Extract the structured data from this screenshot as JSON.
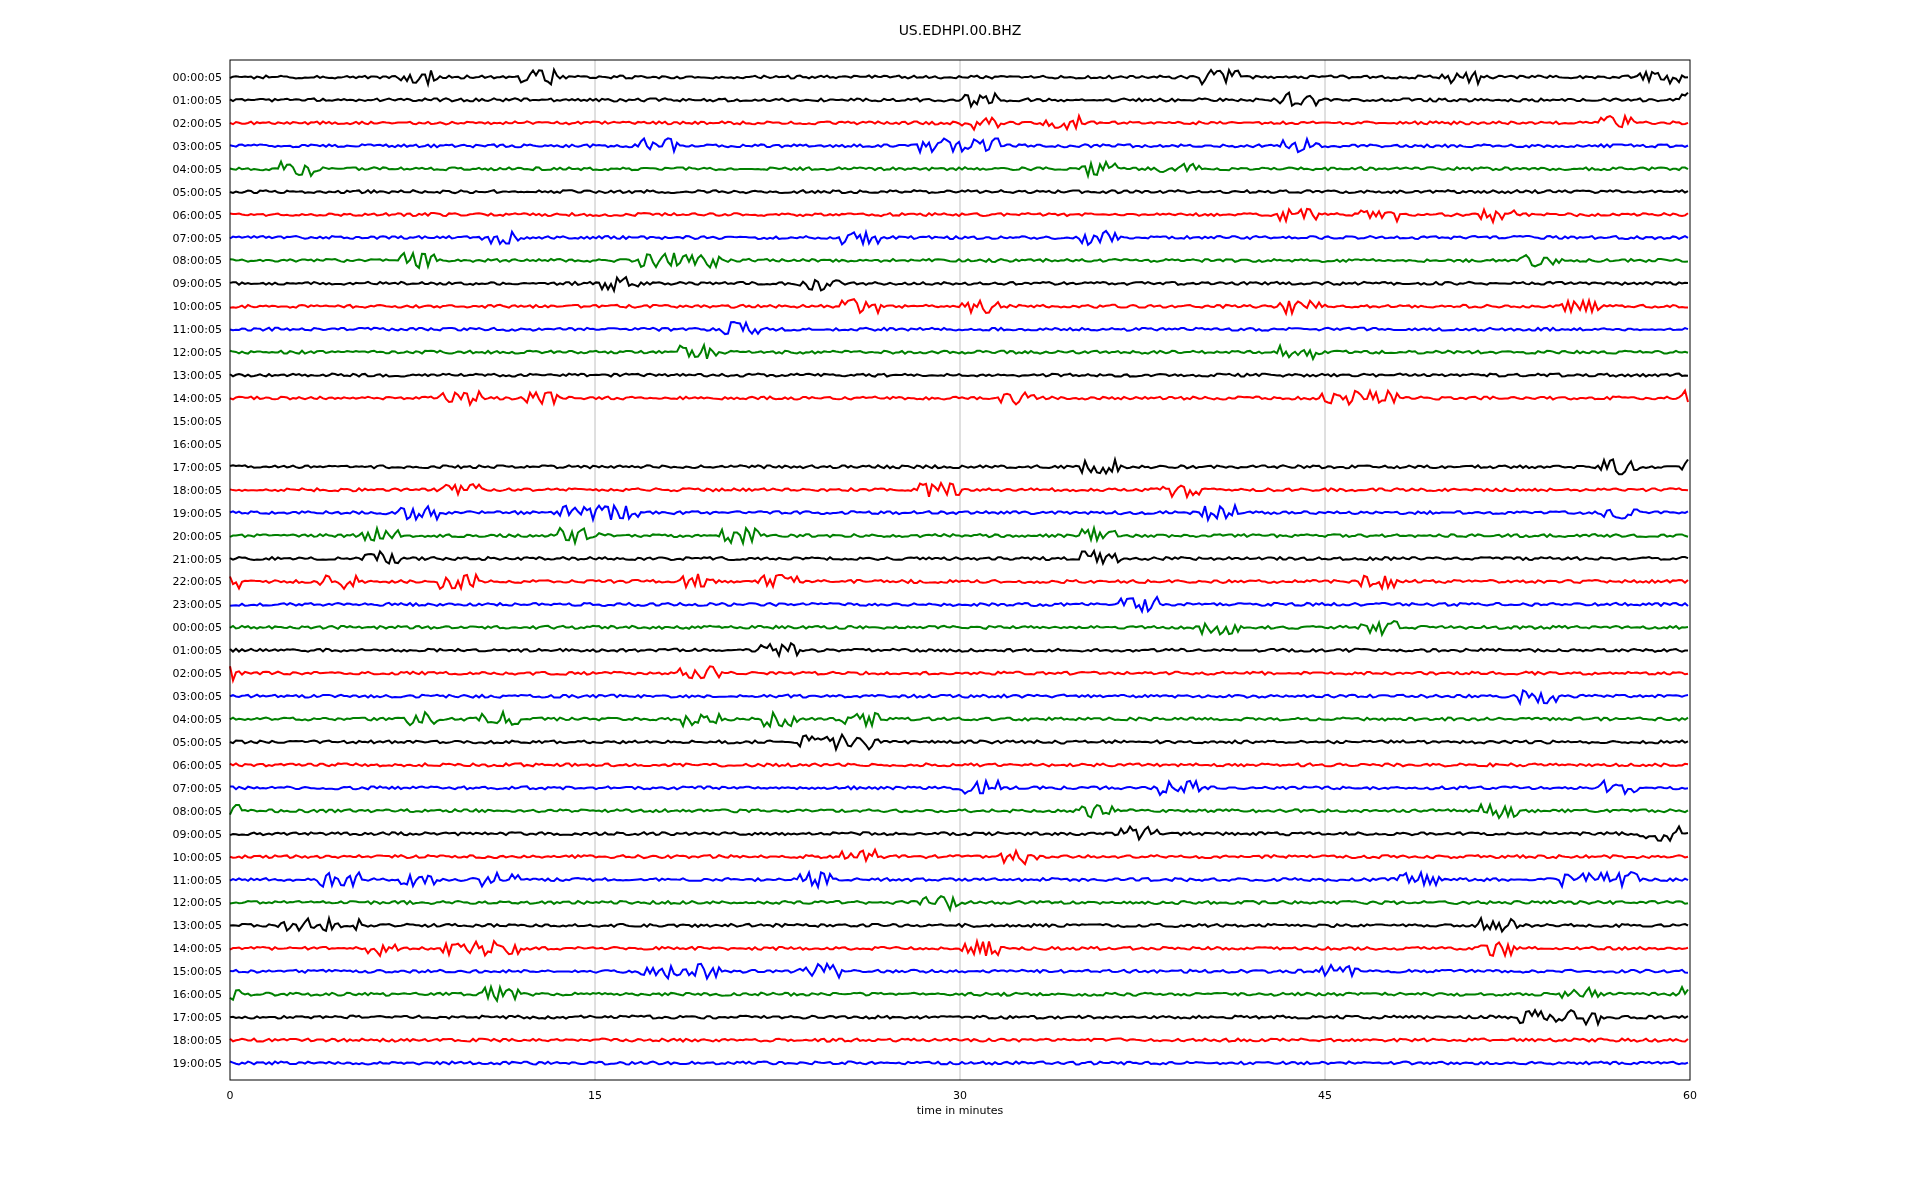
{
  "figure": {
    "title": "US.EDHPI.00.BHZ",
    "xticks": [
      "0",
      "15",
      "30",
      "45",
      "60"
    ],
    "xlabel": "time in minutes",
    "rows": [
      {
        "label": "00:00:05",
        "kind": "trace",
        "color": "#000000"
      },
      {
        "label": "01:00:05",
        "kind": "trace",
        "color": "#000000"
      },
      {
        "label": "02:00:05",
        "kind": "trace",
        "color": "#ff0000"
      },
      {
        "label": "03:00:05",
        "kind": "trace",
        "color": "#0000ff"
      },
      {
        "label": "04:00:05",
        "kind": "trace",
        "color": "#008000"
      },
      {
        "label": "05:00:05",
        "kind": "trace",
        "color": "#000000"
      },
      {
        "label": "06:00:05",
        "kind": "trace",
        "color": "#ff0000"
      },
      {
        "label": "07:00:05",
        "kind": "trace",
        "color": "#0000ff"
      },
      {
        "label": "08:00:05",
        "kind": "trace",
        "color": "#008000"
      },
      {
        "label": "09:00:05",
        "kind": "trace",
        "color": "#000000"
      },
      {
        "label": "10:00:05",
        "kind": "trace",
        "color": "#ff0000"
      },
      {
        "label": "11:00:05",
        "kind": "trace",
        "color": "#0000ff"
      },
      {
        "label": "12:00:05",
        "kind": "trace",
        "color": "#008000"
      },
      {
        "label": "13:00:05",
        "kind": "trace",
        "color": "#000000"
      },
      {
        "label": "14:00:05",
        "kind": "trace",
        "color": "#ff0000"
      },
      {
        "label": "15:00:05",
        "kind": "gap"
      },
      {
        "label": "16:00:05",
        "kind": "gap"
      },
      {
        "label": "17:00:05",
        "kind": "trace",
        "color": "#000000"
      },
      {
        "label": "18:00:05",
        "kind": "trace",
        "color": "#ff0000"
      },
      {
        "label": "19:00:05",
        "kind": "trace",
        "color": "#0000ff"
      },
      {
        "label": "20:00:05",
        "kind": "trace",
        "color": "#008000"
      },
      {
        "label": "21:00:05",
        "kind": "trace",
        "color": "#000000"
      },
      {
        "label": "22:00:05",
        "kind": "trace",
        "color": "#ff0000"
      },
      {
        "label": "23:00:05",
        "kind": "trace",
        "color": "#0000ff"
      },
      {
        "label": "00:00:05",
        "kind": "trace",
        "color": "#008000"
      },
      {
        "label": "01:00:05",
        "kind": "trace",
        "color": "#000000"
      },
      {
        "label": "02:00:05",
        "kind": "trace",
        "color": "#ff0000"
      },
      {
        "label": "03:00:05",
        "kind": "trace",
        "color": "#0000ff"
      },
      {
        "label": "04:00:05",
        "kind": "trace",
        "color": "#008000"
      },
      {
        "label": "05:00:05",
        "kind": "trace",
        "color": "#000000"
      },
      {
        "label": "06:00:05",
        "kind": "trace",
        "color": "#ff0000"
      },
      {
        "label": "07:00:05",
        "kind": "trace",
        "color": "#0000ff"
      },
      {
        "label": "08:00:05",
        "kind": "trace",
        "color": "#008000"
      },
      {
        "label": "09:00:05",
        "kind": "trace",
        "color": "#000000"
      },
      {
        "label": "10:00:05",
        "kind": "trace",
        "color": "#ff0000"
      },
      {
        "label": "11:00:05",
        "kind": "trace",
        "color": "#0000ff"
      },
      {
        "label": "12:00:05",
        "kind": "trace",
        "color": "#008000"
      },
      {
        "label": "13:00:05",
        "kind": "trace",
        "color": "#000000"
      },
      {
        "label": "14:00:05",
        "kind": "trace",
        "color": "#ff0000"
      },
      {
        "label": "15:00:05",
        "kind": "trace",
        "color": "#0000ff"
      },
      {
        "label": "16:00:05",
        "kind": "trace",
        "color": "#008000"
      },
      {
        "label": "17:00:05",
        "kind": "trace",
        "color": "#000000"
      },
      {
        "label": "18:00:05",
        "kind": "trace",
        "color": "#ff0000"
      },
      {
        "label": "19:00:05",
        "kind": "trace",
        "color": "#0000ff"
      }
    ]
  }
}
